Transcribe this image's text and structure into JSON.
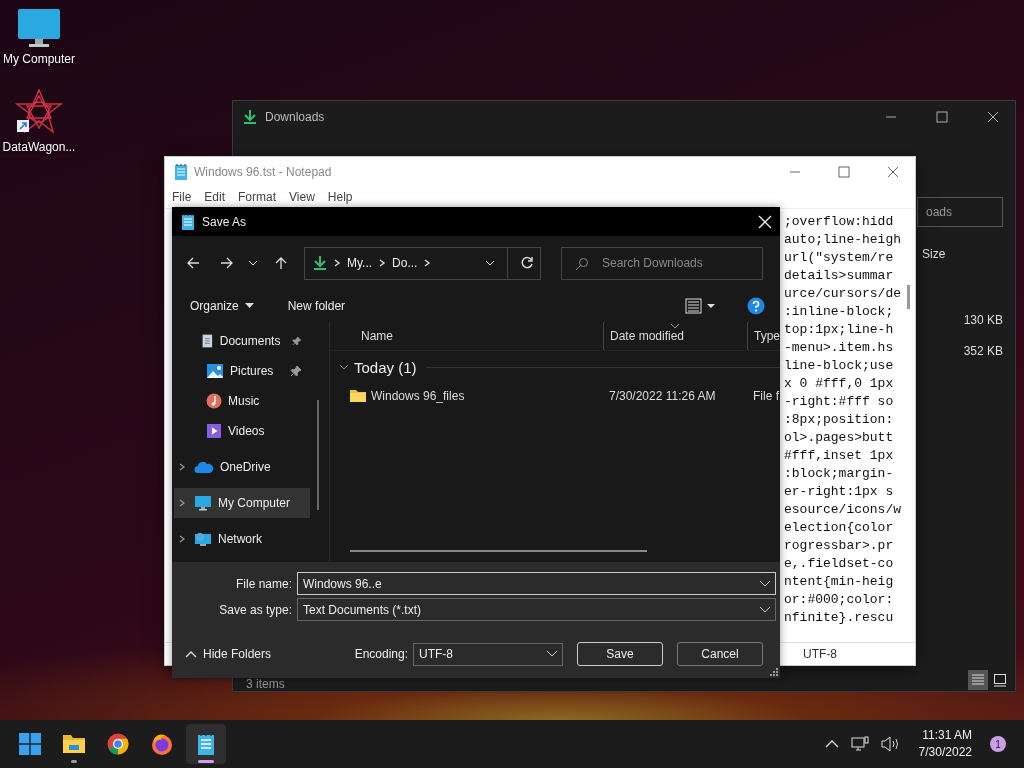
{
  "desktop_icons": [
    {
      "label": "My Computer",
      "kind": "computer"
    },
    {
      "label": "DataWagon...",
      "kind": "shortcut"
    }
  ],
  "downloads_window": {
    "title": "Downloads",
    "search_placeholder": "oads",
    "size_column": "Size",
    "sizes": [
      "130 KB",
      "352 KB"
    ],
    "status": "3 items",
    "views": [
      {
        "kind": "details",
        "selected": true
      },
      {
        "kind": "tiles",
        "selected": false
      }
    ]
  },
  "notepad": {
    "title": "Windows 96.tst - Notepad",
    "menu": [
      "File",
      "Edit",
      "Format",
      "View",
      "Help"
    ],
    "lines": [
      ";overflow:hidd",
      "auto;line-heigh",
      "url(\"system/re",
      "details>summar",
      "urce/cursors/de",
      ":inline-block;",
      "top:1px;line-h",
      "-menu>.item.hs",
      "line-block;use",
      "x 0 #fff,0 1px",
      "-right:#fff so",
      ":8px;position:",
      "ol>.pages>butt",
      "#fff,inset 1px",
      ":block;margin-",
      "er-right:1px s",
      "esource/icons/w",
      "election{color",
      "rogressbar>.pr",
      "e,.fieldset-co",
      "ntent{min-heig",
      "or:#000;color:",
      "nfinite}.rescu"
    ],
    "encoding": "UTF-8"
  },
  "save_dialog": {
    "title": "Save As",
    "breadcrumbs": [
      "My...",
      "Do..."
    ],
    "search_placeholder": "Search Downloads",
    "organize": "Organize",
    "new_folder": "New folder",
    "nav_items": [
      {
        "label": "Documents",
        "kind": "documents",
        "pinned": true,
        "expandable": false,
        "selected": false
      },
      {
        "label": "Pictures",
        "kind": "pictures",
        "pinned": true,
        "expandable": false,
        "selected": false
      },
      {
        "label": "Music",
        "kind": "music",
        "pinned": false,
        "expandable": false,
        "selected": false
      },
      {
        "label": "Videos",
        "kind": "videos",
        "pinned": false,
        "expandable": false,
        "selected": false
      },
      {
        "label": "OneDrive",
        "kind": "cloud",
        "pinned": false,
        "expandable": true,
        "selected": false
      },
      {
        "label": "My Computer",
        "kind": "computer",
        "pinned": false,
        "expandable": true,
        "selected": true
      },
      {
        "label": "Network",
        "kind": "network",
        "pinned": false,
        "expandable": true,
        "selected": false
      }
    ],
    "columns": [
      {
        "label": "Name",
        "sorted": false
      },
      {
        "label": "Date modified",
        "sorted": true
      },
      {
        "label": "Type",
        "sorted": false
      }
    ],
    "group": {
      "label": "Today (1)",
      "expanded": true
    },
    "files": [
      {
        "name": "Windows 96_files",
        "kind": "folder",
        "date": "7/30/2022 11:26 AM",
        "type": "File f"
      }
    ],
    "file_name_label": "File name:",
    "file_name": "Windows 96..e",
    "type_label": "Save as type:",
    "type_value": "Text Documents (*.txt)",
    "hide_folders": "Hide Folders",
    "encoding_label": "Encoding:",
    "encoding": "UTF-8",
    "buttons": [
      "Save",
      "Cancel"
    ]
  },
  "taskbar": {
    "apps": [
      {
        "kind": "start",
        "running": false,
        "active": false
      },
      {
        "kind": "explorer",
        "running": true,
        "active": false
      },
      {
        "kind": "chrome",
        "running": false,
        "active": false
      },
      {
        "kind": "firefox",
        "running": false,
        "active": false
      },
      {
        "kind": "notepad",
        "running": true,
        "active": true
      }
    ],
    "time": "11:31 AM",
    "date": "7/30/2022",
    "notifications": "1"
  }
}
